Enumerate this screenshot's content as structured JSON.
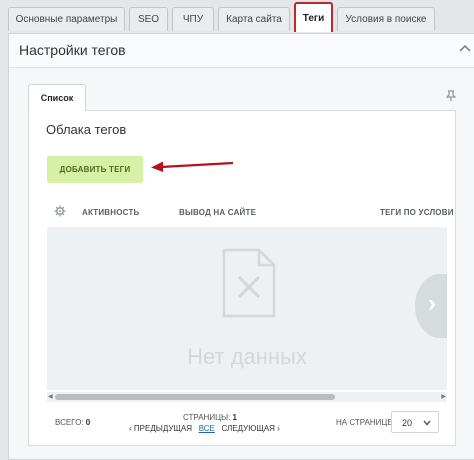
{
  "tabs": [
    {
      "label": "Основные параметры"
    },
    {
      "label": "SEO"
    },
    {
      "label": "ЧПУ"
    },
    {
      "label": "Карта сайта"
    },
    {
      "label": "Теги"
    },
    {
      "label": "Условия в поиске"
    }
  ],
  "active_tab": "Теги",
  "panel": {
    "title": "Настройки тегов"
  },
  "inner": {
    "tab_label": "Список",
    "card_title": "Облака тегов",
    "add_button": "ДОБАВИТЬ ТЕГИ",
    "columns": [
      "АКТИВНОСТЬ",
      "ВЫВОД НА САЙТЕ",
      "ТЕГИ ПО УСЛОВИ"
    ],
    "empty_text": "Нет данных"
  },
  "footer": {
    "total_label": "ВСЕГО:",
    "total_value": "0",
    "pages_label": "СТРАНИЦЫ:",
    "pages_value": "1",
    "prev": "ПРЕДЫДУЩАЯ",
    "all": "ВСЕ",
    "next": "СЛЕДУЮЩАЯ",
    "per_page_label": "НА СТРАНИЦЕ:",
    "per_page_value": "20"
  },
  "colors": {
    "accent_border": "#c0272d",
    "button_bg": "#d6f0a7",
    "arrow": "#b3141b"
  }
}
